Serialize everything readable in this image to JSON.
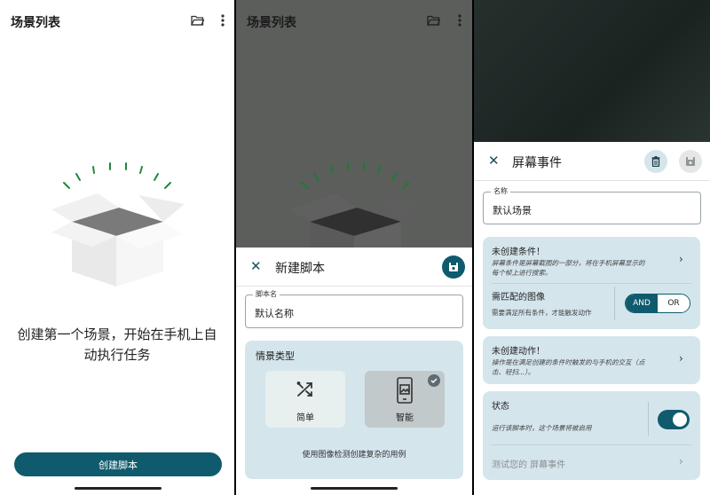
{
  "panel1": {
    "title": "场景列表",
    "empty_message_line1": "创建第一个场景，开始在手机上自",
    "empty_message_line2": "动执行任务",
    "create_button": "创建脚本",
    "icons": [
      "folder-open-icon",
      "more-vert-icon",
      "empty-box-illustration"
    ]
  },
  "panel2": {
    "title": "场景列表",
    "sheet": {
      "title": "新建脚本",
      "name_field_label": "脚本名",
      "name_field_value": "默认名称",
      "scenario_type_title": "情景类型",
      "options": [
        {
          "label": "简单",
          "icon": "shuffle-icon",
          "selected": false
        },
        {
          "label": "智能",
          "icon": "phone-image-icon",
          "selected": true
        }
      ],
      "hint": "使用图像检测创建复杂的用例"
    }
  },
  "panel3": {
    "sheet": {
      "title": "屏幕事件",
      "name_field_label": "名称",
      "name_field_value": "默认场景",
      "conditions": {
        "title": "未创建条件！",
        "subtitle_line1": "屏幕条件是屏幕截图的一部分，将在手机屏幕显示的",
        "subtitle_line2": "每个帧上进行搜索。",
        "match_title": "需匹配的图像",
        "match_sub": "需要满足所有条件，才能触发动作",
        "and_label": "AND",
        "or_label": "OR",
        "selected": "AND"
      },
      "actions": {
        "title": "未创建动作！",
        "subtitle_line1": "操作是在满足创建的条件时触发的与手机的交互（点",
        "subtitle_line2": "击、轻扫...）。"
      },
      "state": {
        "title": "状态",
        "subtitle": "运行该脚本时，这个场景将被启用",
        "enabled": true
      },
      "test_label": "测试您的 屏幕事件"
    }
  },
  "colors": {
    "primary": "#0f5b6d",
    "card": "#d5e5ec",
    "scrim": "#5b5e5b"
  }
}
